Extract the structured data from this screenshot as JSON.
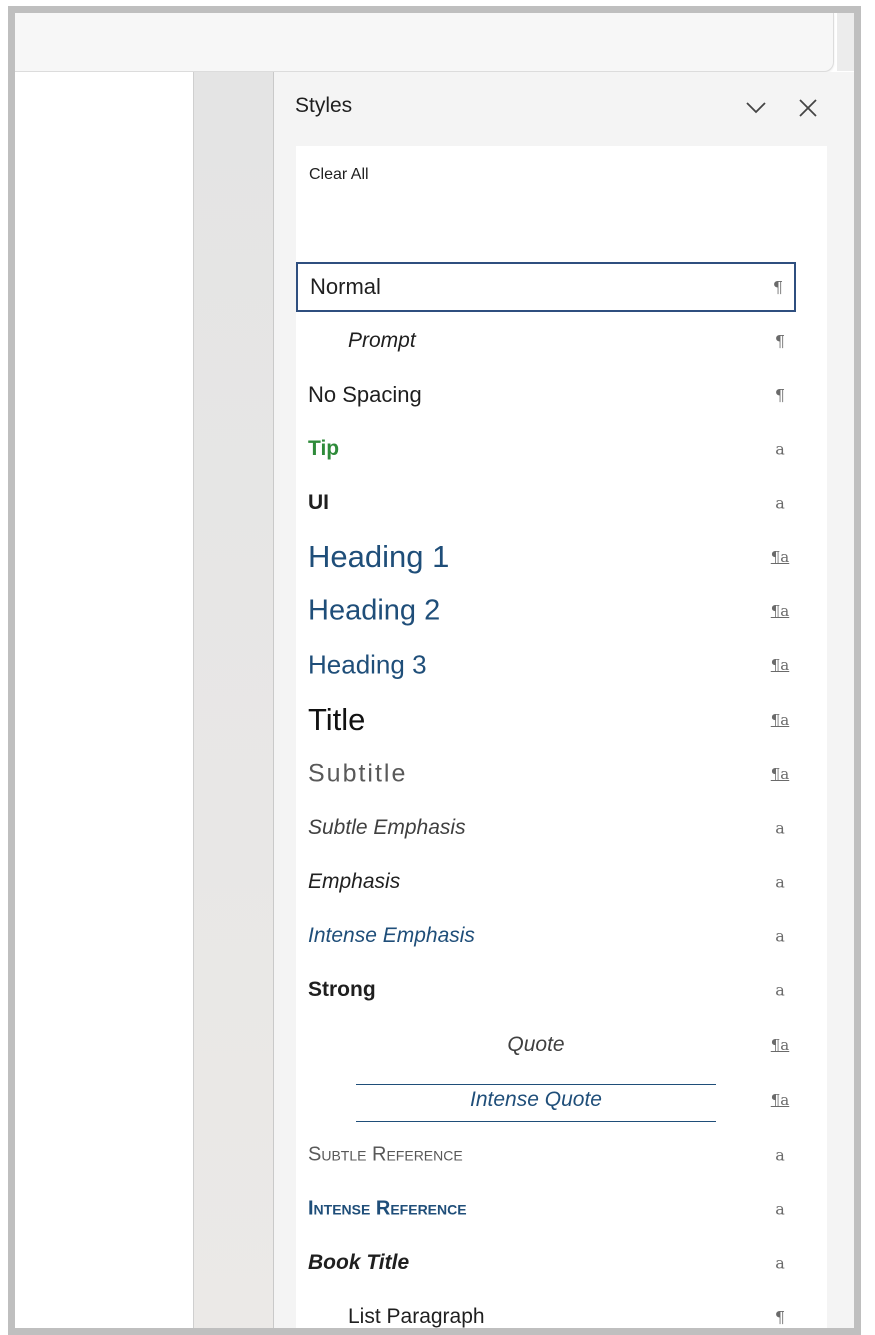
{
  "pane": {
    "title": "Styles",
    "clear_all": "Clear All"
  },
  "styles": [
    {
      "name": "Normal",
      "type": "¶"
    },
    {
      "name": "Prompt",
      "type": "¶"
    },
    {
      "name": "No Spacing",
      "type": "¶"
    },
    {
      "name": "Tip",
      "type": "a"
    },
    {
      "name": "UI",
      "type": "a"
    },
    {
      "name": "Heading 1",
      "type": "¶a"
    },
    {
      "name": "Heading 2",
      "type": "¶a"
    },
    {
      "name": "Heading 3",
      "type": "¶a"
    },
    {
      "name": "Title",
      "type": "¶a"
    },
    {
      "name": "Subtitle",
      "type": "¶a"
    },
    {
      "name": "Subtle Emphasis",
      "type": "a"
    },
    {
      "name": "Emphasis",
      "type": "a"
    },
    {
      "name": "Intense Emphasis",
      "type": "a"
    },
    {
      "name": "Strong",
      "type": "a"
    },
    {
      "name": "Quote",
      "type": "¶a"
    },
    {
      "name": "Intense Quote",
      "type": "¶a"
    },
    {
      "name": "Subtle Reference",
      "type": "a"
    },
    {
      "name": "Intense Reference",
      "type": "a"
    },
    {
      "name": "Book Title",
      "type": "a"
    },
    {
      "name": "List Paragraph",
      "type": "¶"
    }
  ],
  "colors": {
    "selected_border": "#2f4f7f",
    "heading": "#1f4e79",
    "tip": "#2e8b3a"
  }
}
